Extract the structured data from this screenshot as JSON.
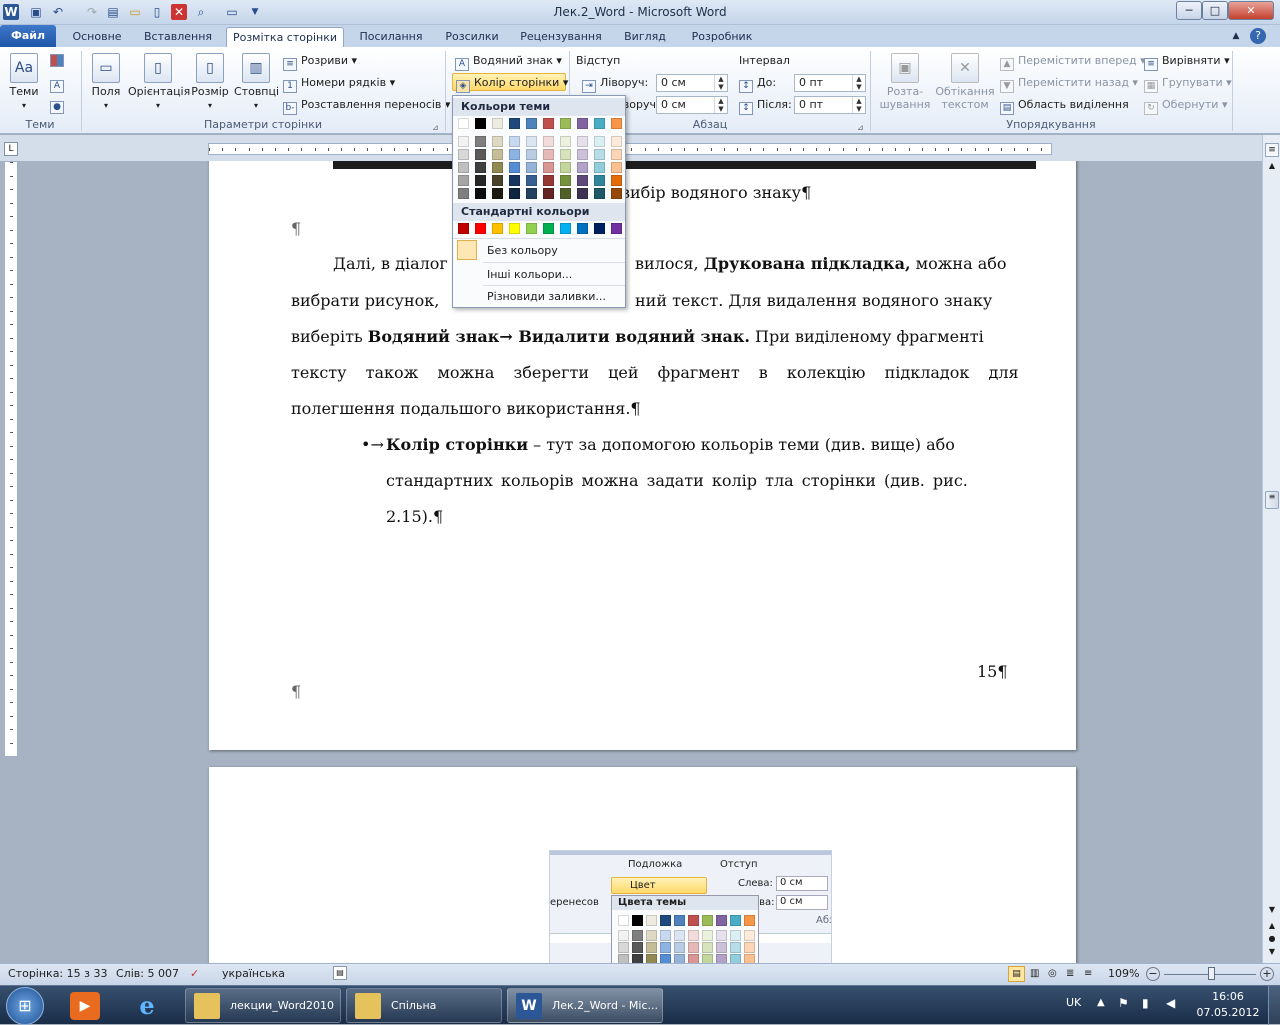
{
  "window": {
    "title": "Лек.2_Word  -  Microsoft Word",
    "min": "─",
    "max": "□",
    "close": "✕"
  },
  "tabs": [
    "Основне",
    "Вставлення",
    "Розмітка сторінки",
    "Посилання",
    "Розсилки",
    "Рецензування",
    "Вигляд",
    "Розробник"
  ],
  "file_tab": "Файл",
  "ribbon": {
    "themes": {
      "label": "Теми",
      "group": "Теми"
    },
    "page_setup": {
      "group": "Параметри сторінки",
      "margins": "Поля",
      "orientation": "Орієнтація",
      "size": "Розмір",
      "columns": "Стовпці",
      "breaks": "Розриви",
      "line_numbers": "Номери рядків",
      "hyphenation": "Розставлення переносів"
    },
    "background": {
      "watermark": "Водяний знак",
      "page_color": "Колір сторінки"
    },
    "paragraph": {
      "group": "Абзац",
      "indent": "Відступ",
      "left": "Ліворуч:",
      "left_value": "0 см",
      "right": "Праворуч:",
      "right_value": "0 см",
      "spacing": "Інтервал",
      "before": "До:",
      "before_value": "0 пт",
      "after": "Після:",
      "after_value": "0 пт"
    },
    "arrange": {
      "group": "Упорядкування",
      "position_l1": "Розта-",
      "position_l2": "шування",
      "wrap_l1": "Обтікання",
      "wrap_l2": "текстом",
      "bring_forward": "Перемістити вперед",
      "send_backward": "Перемістити назад",
      "selection_pane": "Область виділення",
      "align": "Вирівняти",
      "group_btn": "Групувати",
      "rotate": "Обернути"
    }
  },
  "color_menu": {
    "theme_header": "Кольори теми",
    "standard_header": "Стандартні кольори",
    "no_color": "Без кольору",
    "more_colors": "Інші кольори...",
    "fill_effects": "Різновиди заливки...",
    "theme_top": [
      "#ffffff",
      "#000000",
      "#eeece1",
      "#1f497d",
      "#4f81bd",
      "#c0504d",
      "#9bbb59",
      "#8064a2",
      "#4bacc6",
      "#f79646"
    ],
    "shades": [
      [
        "#f2f2f2",
        "#d8d8d8",
        "#bfbfbf",
        "#a5a5a5",
        "#7f7f7f"
      ],
      [
        "#7f7f7f",
        "#595959",
        "#3f3f3f",
        "#262626",
        "#0c0c0c"
      ],
      [
        "#ddd9c3",
        "#c4bd97",
        "#938953",
        "#494429",
        "#1d1b10"
      ],
      [
        "#c6d9f0",
        "#8db3e2",
        "#548dd4",
        "#17365d",
        "#0f243e"
      ],
      [
        "#dbe5f1",
        "#b8cce4",
        "#95b3d7",
        "#366092",
        "#244061"
      ],
      [
        "#f2dcdb",
        "#e5b9b7",
        "#d99694",
        "#953734",
        "#632423"
      ],
      [
        "#ebf1dd",
        "#d7e3bc",
        "#c3d69b",
        "#76923c",
        "#4f6128"
      ],
      [
        "#e5e0ec",
        "#ccc1d9",
        "#b2a2c7",
        "#5f497a",
        "#3f3151"
      ],
      [
        "#dbeef3",
        "#b7dde8",
        "#92cddc",
        "#31859b",
        "#205867"
      ],
      [
        "#fdeada",
        "#fbd5b5",
        "#fac08f",
        "#e36c09",
        "#974806"
      ]
    ],
    "standard": [
      "#c00000",
      "#ff0000",
      "#ffc000",
      "#ffff00",
      "#92d050",
      "#00b050",
      "#00b0f0",
      "#0070c0",
      "#002060",
      "#7030a0"
    ]
  },
  "document": {
    "caption": "вибір водяного знаку¶",
    "pilcrow": "¶",
    "p1_l1_start": "Далі, в діалог",
    "p1_l1_mid": "вилося,",
    "p1_l1_bold": "Друкована підкладка,",
    "p1_l1_end": "можна або",
    "p1_l2_start": "вибрати рисунок,",
    "p1_l2_end": "ний текст. Для видалення водяного знаку",
    "p1_l3_start": "виберіть",
    "p1_l3_bold": "Водяний знак→ Видалити водяний знак.",
    "p1_l3_end": "При виділеному фрагменті",
    "p1_l4": "тексту також можна зберегти цей фрагмент в колекцію підкладок для",
    "p1_l5": "полегшення подальшого використання.¶",
    "bullet": "•→",
    "b_bold": "Колір сторінки",
    "b_l1_end": " – тут за допомогою кольорів теми (див. вище) або",
    "b_l2": "стандартних кольорів можна задати колір тла сторінки (див. рис.",
    "b_l3": "2.15).¶",
    "page_number": "15¶",
    "embedded": {
      "watermark": "Подложка",
      "page_color": "Цвет страницы",
      "indent": "Отступ",
      "left": "Слева:",
      "left_value": "0 см",
      "right": "ава:",
      "right_value": "0 см",
      "hyph": "еренесов",
      "theme_colors": "Цвета темы",
      "abz": "Абз"
    }
  },
  "status": {
    "page": "Сторінка: 15 з 33",
    "words": "Слів: 5 007",
    "language": "українська",
    "zoom": "109%"
  },
  "taskbar": {
    "item1": "лекции_Word2010",
    "item2": "Спільна",
    "item3": "Лек.2_Word - Mic...",
    "lang": "UK",
    "time": "16:06",
    "date": "07.05.2012"
  }
}
